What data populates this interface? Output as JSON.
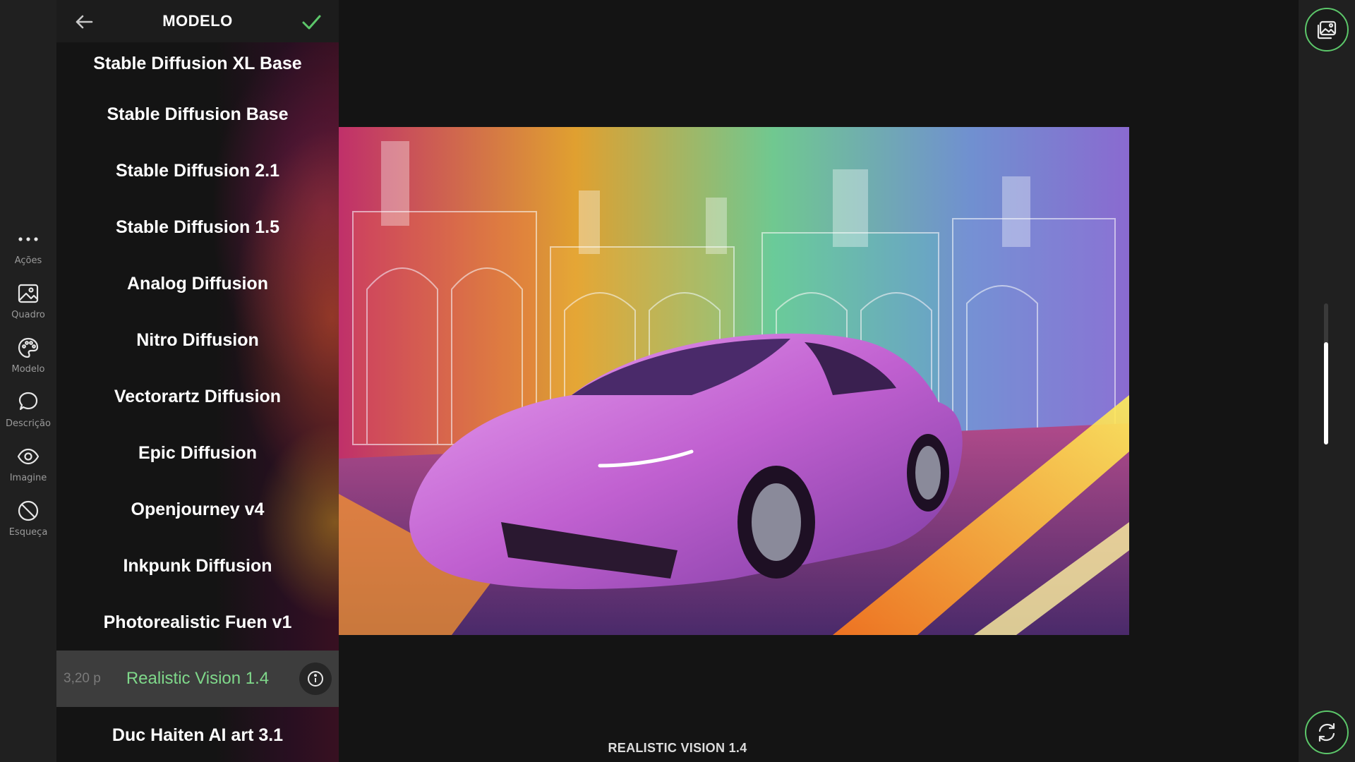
{
  "rail": {
    "items": [
      {
        "label": "Ações",
        "icon": "more-dots-icon"
      },
      {
        "label": "Quadro",
        "icon": "image-frame-icon"
      },
      {
        "label": "Modelo",
        "icon": "palette-icon"
      },
      {
        "label": "Descrição",
        "icon": "chat-bubble-icon"
      },
      {
        "label": "Imagine",
        "icon": "eye-icon"
      },
      {
        "label": "Esqueça",
        "icon": "ban-icon"
      }
    ]
  },
  "panel": {
    "title": "MODELO",
    "back_icon": "arrow-left-icon",
    "confirm_icon": "check-icon",
    "models": [
      "Stable Diffusion XL Base",
      "Stable Diffusion Base",
      "Stable Diffusion 2.1",
      "Stable Diffusion 1.5",
      "Analog Diffusion",
      "Nitro Diffusion",
      "Vectorartz Diffusion",
      "Epic Diffusion",
      "Openjourney v4",
      "Inkpunk Diffusion",
      "Photorealistic Fuen v1"
    ],
    "selected": {
      "name": "Realistic Vision 1.4",
      "price": "3,20 p",
      "info_icon": "info-icon"
    },
    "after_selected": [
      "Duc Haiten AI art 3.1"
    ]
  },
  "canvas": {
    "caption": "REALISTIC VISION 1.4",
    "accent_colors": [
      "#ff3fa0",
      "#ffb020",
      "#40e0c0",
      "#c070e0"
    ]
  },
  "right_rail": {
    "gallery_icon": "gallery-icon",
    "refresh_icon": "refresh-icon",
    "scroll_fraction": 0.73
  },
  "colors": {
    "accent": "#5cc76a",
    "selected_text": "#7fd88a",
    "background": "#141414"
  }
}
